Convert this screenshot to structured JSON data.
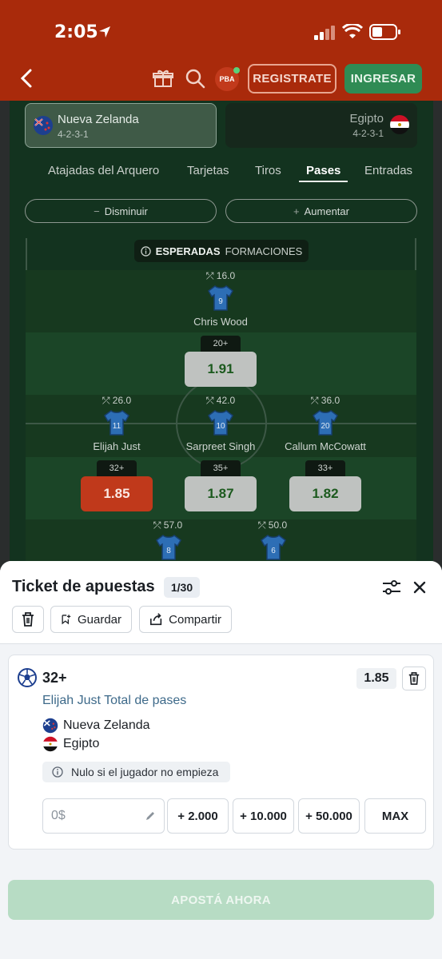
{
  "status_bar": {
    "time": "2:05"
  },
  "header": {
    "pba_badge": "PBA",
    "register_label": "REGISTRATE",
    "login_label": "INGRESAR"
  },
  "match": {
    "home": {
      "name": "Nueva Zelanda",
      "formation": "4-2-3-1"
    },
    "away": {
      "name": "Egipto",
      "formation": "4-2-3-1"
    }
  },
  "tabs": [
    "Atajadas del Arquero",
    "Tarjetas",
    "Tiros",
    "Pases",
    "Entradas"
  ],
  "active_tab": "Pases",
  "controls": {
    "decrease": "Disminuir",
    "decrease_sign": "−",
    "increase": "Aumentar",
    "increase_sign": "+"
  },
  "formation_banner": {
    "bold": "ESPERADAS",
    "rest": "FORMACIONES"
  },
  "players": [
    {
      "name": "Chris Wood",
      "number": "9",
      "rating": "16.0",
      "line": "20+",
      "odd": "1.91",
      "selected": false
    },
    {
      "name": "Elijah Just",
      "number": "11",
      "rating": "26.0",
      "line": "32+",
      "odd": "1.85",
      "selected": true
    },
    {
      "name": "Sarpreet Singh",
      "number": "10",
      "rating": "42.0",
      "line": "35+",
      "odd": "1.87",
      "selected": false
    },
    {
      "name": "Callum McCowatt",
      "number": "20",
      "rating": "36.0",
      "line": "33+",
      "odd": "1.82",
      "selected": false
    },
    {
      "name": "",
      "number": "8",
      "rating": "57.0"
    },
    {
      "name": "",
      "number": "6",
      "rating": "50.0"
    }
  ],
  "ticket": {
    "title": "Ticket de apuestas",
    "count": "1/30",
    "save_label": "Guardar",
    "share_label": "Compartir",
    "selection": {
      "line": "32+",
      "odd": "1.85",
      "market": "Elijah Just Total de pases",
      "home": "Nueva Zelanda",
      "away": "Egipto",
      "note": "Nulo si el jugador no empieza"
    },
    "stake_placeholder": "0$",
    "quick_stakes": [
      "+ 2.000",
      "+ 10.000",
      "+ 50.000",
      "MAX"
    ],
    "place_bet_label": "APOSTÁ AHORA"
  },
  "colors": {
    "brand": "#a92a0b",
    "login_green": "#2f8b54",
    "odd_text": "#1c5a1e",
    "selected_odd": "#c0391b",
    "place_bet": "#b7dcc4"
  }
}
